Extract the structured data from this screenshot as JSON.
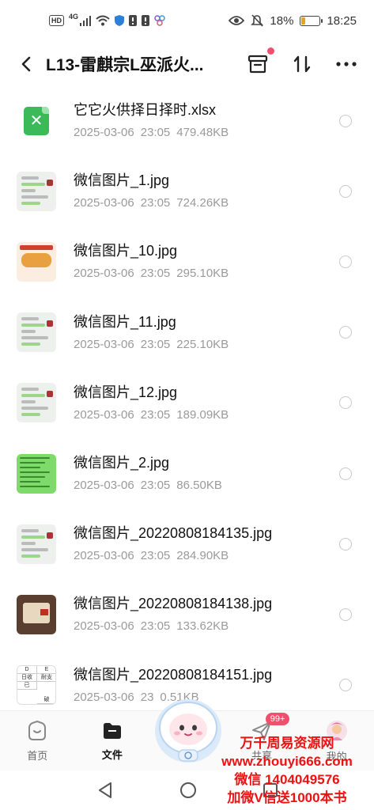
{
  "status_bar": {
    "hd": "HD",
    "network": "4G",
    "battery_percent": "18%",
    "battery_level": 0.18,
    "time": "18:25"
  },
  "header": {
    "title": "L13-雷麒宗L巫派火...",
    "icons": [
      "back-icon",
      "archive-icon",
      "sort-icon",
      "more-icon"
    ]
  },
  "files": [
    {
      "name": "它它火供择日择时.xlsx",
      "date": "2025-03-06",
      "time": "23:05",
      "size": "479.48KB",
      "thumb": "xlsx"
    },
    {
      "name": "微信图片_1.jpg",
      "date": "2025-03-06",
      "time": "23:05",
      "size": "724.26KB",
      "thumb": "chat"
    },
    {
      "name": "微信图片_10.jpg",
      "date": "2025-03-06",
      "time": "23:05",
      "size": "295.10KB",
      "thumb": "orange"
    },
    {
      "name": "微信图片_11.jpg",
      "date": "2025-03-06",
      "time": "23:05",
      "size": "225.10KB",
      "thumb": "chat"
    },
    {
      "name": "微信图片_12.jpg",
      "date": "2025-03-06",
      "time": "23:05",
      "size": "189.09KB",
      "thumb": "chat"
    },
    {
      "name": "微信图片_2.jpg",
      "date": "2025-03-06",
      "time": "23:05",
      "size": "86.50KB",
      "thumb": "green"
    },
    {
      "name": "微信图片_20220808184135.jpg",
      "date": "2025-03-06",
      "time": "23:05",
      "size": "284.90KB",
      "thumb": "chat"
    },
    {
      "name": "微信图片_20220808184138.jpg",
      "date": "2025-03-06",
      "time": "23:05",
      "size": "133.62KB",
      "thumb": "photo"
    },
    {
      "name": "微信图片_20220808184151.jpg",
      "date": "2025-03-06",
      "time": "23",
      "size": "0.51KB",
      "thumb": "sheet"
    }
  ],
  "thumb_sheet_cells": {
    "c1": "D",
    "c2": "E",
    "c3": "日收",
    "c4": "耐支",
    "c5": "已",
    "c6": "破"
  },
  "bottom_nav": {
    "home": "首页",
    "files": "文件",
    "share": "共享",
    "share_badge": "99+",
    "mine": "我的"
  },
  "watermark": {
    "line1": "万千周易资源网",
    "line2": "www.zhouyi666.com",
    "line3": "微信 1404049576",
    "line4": "加微V信送1000本书"
  },
  "colors": {
    "accent_red": "#f0506e",
    "watermark_red": "#ee1111",
    "xlsx_green": "#3cba5a"
  }
}
